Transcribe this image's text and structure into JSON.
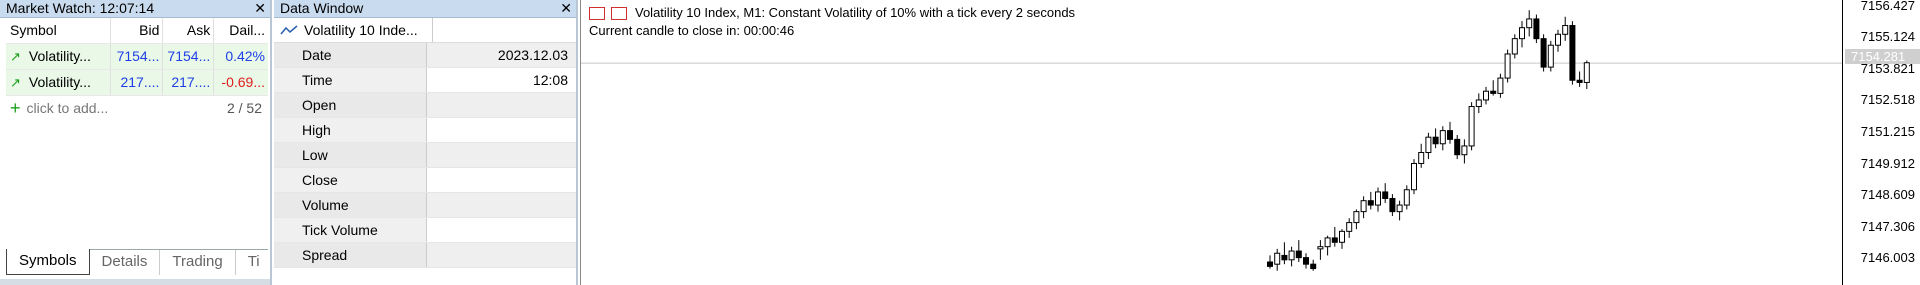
{
  "market_watch": {
    "title": "Market Watch: 12:07:14",
    "close": "✕",
    "columns": [
      "Symbol",
      "Bid",
      "Ask",
      "Dail..."
    ],
    "rows": [
      {
        "symbol": "Volatility...",
        "bid": "7154...",
        "ask": "7154...",
        "daily": "0.42%",
        "daily_color": "#1f3fe6"
      },
      {
        "symbol": "Volatility...",
        "bid": "217....",
        "ask": "217....",
        "daily": "-0.69...",
        "daily_color": "#e02020"
      }
    ],
    "add_label": "click to add...",
    "count": "2 / 52",
    "tabs": [
      "Symbols",
      "Details",
      "Trading",
      "Ti"
    ]
  },
  "data_window": {
    "title": "Data Window",
    "close": "✕",
    "symbol": "Volatility 10 Inde...",
    "rows": [
      {
        "key": "Date",
        "value": "2023.12.03"
      },
      {
        "key": "Time",
        "value": "12:08"
      },
      {
        "key": "Open",
        "value": ""
      },
      {
        "key": "High",
        "value": ""
      },
      {
        "key": "Low",
        "value": ""
      },
      {
        "key": "Close",
        "value": ""
      },
      {
        "key": "Volume",
        "value": ""
      },
      {
        "key": "Tick Volume",
        "value": ""
      },
      {
        "key": "Spread",
        "value": ""
      }
    ]
  },
  "chart": {
    "info_line1": "Volatility 10 Index, M1:  Constant Volatility of 10% with a tick every 2 seconds",
    "info_line2": "Current candle to close in: 00:00:46",
    "current_price": "7154.281",
    "price_labels": [
      "7156.427",
      "7155.124",
      "7153.821",
      "7152.518",
      "7151.215",
      "7149.912",
      "7148.609",
      "7147.306",
      "7146.003"
    ]
  },
  "chart_data": {
    "type": "candlestick",
    "title": "Volatility 10 Index, M1",
    "ylim": [
      7145.2,
      7156.8
    ],
    "current_price": 7154.281,
    "candles": [
      {
        "o": 7145.2,
        "h": 7145.5,
        "l": 7144.9,
        "c": 7145.0
      },
      {
        "o": 7145.1,
        "h": 7145.8,
        "l": 7144.8,
        "c": 7145.6
      },
      {
        "o": 7145.5,
        "h": 7146.1,
        "l": 7145.1,
        "c": 7145.3
      },
      {
        "o": 7145.3,
        "h": 7145.9,
        "l": 7145.0,
        "c": 7145.7
      },
      {
        "o": 7145.7,
        "h": 7146.2,
        "l": 7145.2,
        "c": 7145.4
      },
      {
        "o": 7145.4,
        "h": 7145.6,
        "l": 7144.9,
        "c": 7145.1
      },
      {
        "o": 7145.1,
        "h": 7145.3,
        "l": 7144.8,
        "c": 7144.9
      },
      {
        "o": 7145.8,
        "h": 7146.2,
        "l": 7145.3,
        "c": 7145.9
      },
      {
        "o": 7145.9,
        "h": 7146.4,
        "l": 7145.5,
        "c": 7146.3
      },
      {
        "o": 7146.3,
        "h": 7146.8,
        "l": 7145.9,
        "c": 7146.1
      },
      {
        "o": 7146.1,
        "h": 7146.7,
        "l": 7145.8,
        "c": 7146.6
      },
      {
        "o": 7146.6,
        "h": 7147.2,
        "l": 7146.3,
        "c": 7147.0
      },
      {
        "o": 7147.0,
        "h": 7147.6,
        "l": 7146.7,
        "c": 7147.5
      },
      {
        "o": 7147.5,
        "h": 7148.2,
        "l": 7147.2,
        "c": 7148.0
      },
      {
        "o": 7148.0,
        "h": 7148.4,
        "l": 7147.6,
        "c": 7147.8
      },
      {
        "o": 7147.8,
        "h": 7148.6,
        "l": 7147.5,
        "c": 7148.4
      },
      {
        "o": 7148.4,
        "h": 7148.8,
        "l": 7147.9,
        "c": 7148.1
      },
      {
        "o": 7148.1,
        "h": 7148.3,
        "l": 7147.3,
        "c": 7147.5
      },
      {
        "o": 7147.5,
        "h": 7148.0,
        "l": 7147.1,
        "c": 7147.8
      },
      {
        "o": 7147.8,
        "h": 7148.7,
        "l": 7147.6,
        "c": 7148.5
      },
      {
        "o": 7148.5,
        "h": 7149.9,
        "l": 7148.3,
        "c": 7149.7
      },
      {
        "o": 7149.7,
        "h": 7150.6,
        "l": 7149.5,
        "c": 7150.2
      },
      {
        "o": 7150.2,
        "h": 7151.1,
        "l": 7149.9,
        "c": 7150.9
      },
      {
        "o": 7150.9,
        "h": 7151.3,
        "l": 7150.4,
        "c": 7150.6
      },
      {
        "o": 7150.6,
        "h": 7151.4,
        "l": 7150.3,
        "c": 7151.2
      },
      {
        "o": 7151.2,
        "h": 7151.6,
        "l": 7150.6,
        "c": 7150.8
      },
      {
        "o": 7150.8,
        "h": 7151.0,
        "l": 7149.9,
        "c": 7150.1
      },
      {
        "o": 7150.1,
        "h": 7150.8,
        "l": 7149.7,
        "c": 7150.5
      },
      {
        "o": 7150.5,
        "h": 7152.5,
        "l": 7150.3,
        "c": 7152.3
      },
      {
        "o": 7152.3,
        "h": 7152.9,
        "l": 7152.0,
        "c": 7152.6
      },
      {
        "o": 7152.6,
        "h": 7153.2,
        "l": 7152.4,
        "c": 7153.0
      },
      {
        "o": 7153.0,
        "h": 7153.5,
        "l": 7152.8,
        "c": 7152.9
      },
      {
        "o": 7152.9,
        "h": 7153.8,
        "l": 7152.7,
        "c": 7153.6
      },
      {
        "o": 7153.6,
        "h": 7154.9,
        "l": 7153.4,
        "c": 7154.7
      },
      {
        "o": 7154.7,
        "h": 7155.6,
        "l": 7154.5,
        "c": 7155.4
      },
      {
        "o": 7155.4,
        "h": 7156.2,
        "l": 7155.0,
        "c": 7155.9
      },
      {
        "o": 7155.9,
        "h": 7156.7,
        "l": 7155.5,
        "c": 7156.3
      },
      {
        "o": 7156.3,
        "h": 7156.5,
        "l": 7155.2,
        "c": 7155.4
      },
      {
        "o": 7155.4,
        "h": 7155.6,
        "l": 7153.9,
        "c": 7154.1
      },
      {
        "o": 7154.1,
        "h": 7155.3,
        "l": 7153.9,
        "c": 7155.1
      },
      {
        "o": 7155.1,
        "h": 7155.8,
        "l": 7154.8,
        "c": 7155.6
      },
      {
        "o": 7155.6,
        "h": 7156.4,
        "l": 7155.3,
        "c": 7156.0
      },
      {
        "o": 7156.0,
        "h": 7156.2,
        "l": 7153.3,
        "c": 7153.5
      },
      {
        "o": 7153.5,
        "h": 7153.9,
        "l": 7153.2,
        "c": 7153.4
      },
      {
        "o": 7153.4,
        "h": 7154.4,
        "l": 7153.1,
        "c": 7154.3
      }
    ]
  }
}
